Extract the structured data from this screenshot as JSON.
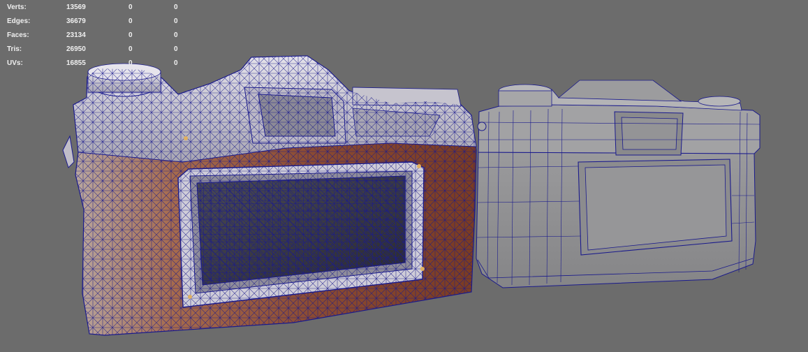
{
  "poly_count": {
    "rows": [
      {
        "label": "Verts:",
        "total": "13569",
        "selected": "0",
        "selected_obj": "0"
      },
      {
        "label": "Edges:",
        "total": "36679",
        "selected": "0",
        "selected_obj": "0"
      },
      {
        "label": "Faces:",
        "total": "23134",
        "selected": "0",
        "selected_obj": "0"
      },
      {
        "label": "Tris:",
        "total": "26950",
        "selected": "0",
        "selected_obj": "0"
      },
      {
        "label": "UVs:",
        "total": "16855",
        "selected": "0",
        "selected_obj": "0"
      }
    ]
  },
  "colors": {
    "viewport_bg": "#6c6c6c",
    "wire": "#1a1a8c",
    "hud_text": "#f0f0f0"
  },
  "objects": [
    {
      "name": "textured-camera-model",
      "shading": "textured-wireframe"
    },
    {
      "name": "lowpoly-camera-model",
      "shading": "shaded-wireframe"
    }
  ]
}
